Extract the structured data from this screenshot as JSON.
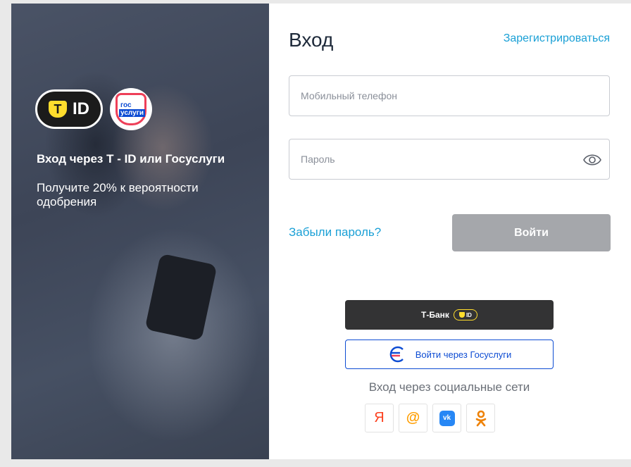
{
  "promo": {
    "tid_badge_text": "ID",
    "tid_shield_letter": "T",
    "gosuslugi_logo_line1": "гос",
    "gosuslugi_logo_line2": "услуги",
    "title": "Вход через Т - ID или Госуслуги",
    "subtitle": "Получите 20% к вероятности одобрения"
  },
  "form": {
    "title": "Вход",
    "register_label": "Зарегистрироваться",
    "phone_placeholder": "Мобильный телефон",
    "password_placeholder": "Пароль",
    "forgot_label": "Забыли пароль?",
    "submit_label": "Войти"
  },
  "alt_login": {
    "tbank_label": "Т-Банк",
    "tbank_badge_text": "ID",
    "gosuslugi_label": "Войти через Госуслуги",
    "social_title": "Вход через социальные сети",
    "socials": {
      "yandex": "Я",
      "mail": "@",
      "vk": "vk",
      "ok": "ok"
    }
  },
  "colors": {
    "accent_link": "#1aa0d6",
    "button_disabled": "#a5a7ab",
    "tbank_dark": "#333334",
    "tid_yellow": "#ffdd2d",
    "gosuslugi_blue": "#0d4cd3",
    "gosuslugi_red": "#ee3f58"
  }
}
